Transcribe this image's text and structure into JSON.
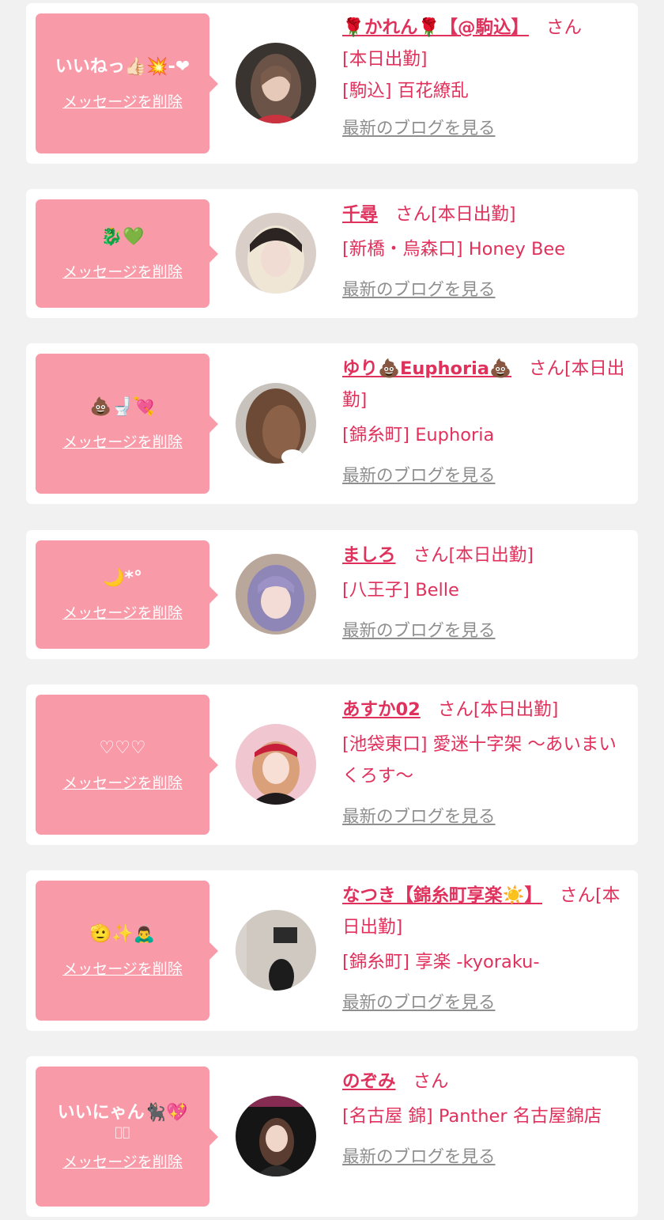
{
  "delete_label": "メッセージを削除",
  "blog_label": "最新のブログを見る",
  "colors": {
    "background": "#f1f1f1",
    "card": "#ffffff",
    "bubble": "#f99aa8",
    "name": "#e0315c",
    "link_gray": "#8e8e8e"
  },
  "entries": [
    {
      "message": "いいねっ👍🏻💥-❤",
      "name": "🌹かれん🌹【@駒込】",
      "suffix": "さん",
      "status": "[本日出勤]",
      "shop": "[駒込] 百花繚乱"
    },
    {
      "message": "🐉💚",
      "name": "千尋",
      "suffix": "さん[本日出勤]",
      "status": "",
      "shop": "[新橋・烏森口] Honey Bee"
    },
    {
      "message": "💩🚽💘",
      "name": "ゆり💩Euphoria💩",
      "suffix": "さん[本日出勤]",
      "status": "",
      "shop": "[錦糸町] Euphoria"
    },
    {
      "message": "🌙*°",
      "name": "ましろ",
      "suffix": "さん[本日出勤]",
      "status": "",
      "shop": "[八王子] Belle"
    },
    {
      "message": "♡♡♡",
      "name": "あすか02",
      "suffix": "さん[本日出勤]",
      "status": "",
      "shop": "[池袋東口] 愛迷十字架 〜あいまいくろす〜"
    },
    {
      "message": "🫡✨🙇‍♂️",
      "name": "なつき【錦糸町享楽☀️】",
      "suffix": "さん[本日出勤]",
      "status": "",
      "shop": "[錦糸町] 享楽 -kyoraku-"
    },
    {
      "message": "いいにゃん🐈‍⬛💖",
      "message2": "􀀀􀀀",
      "name": "のぞみ",
      "suffix": "さん",
      "status": "",
      "shop": "[名古屋 錦] Panther 名古屋錦店"
    }
  ]
}
